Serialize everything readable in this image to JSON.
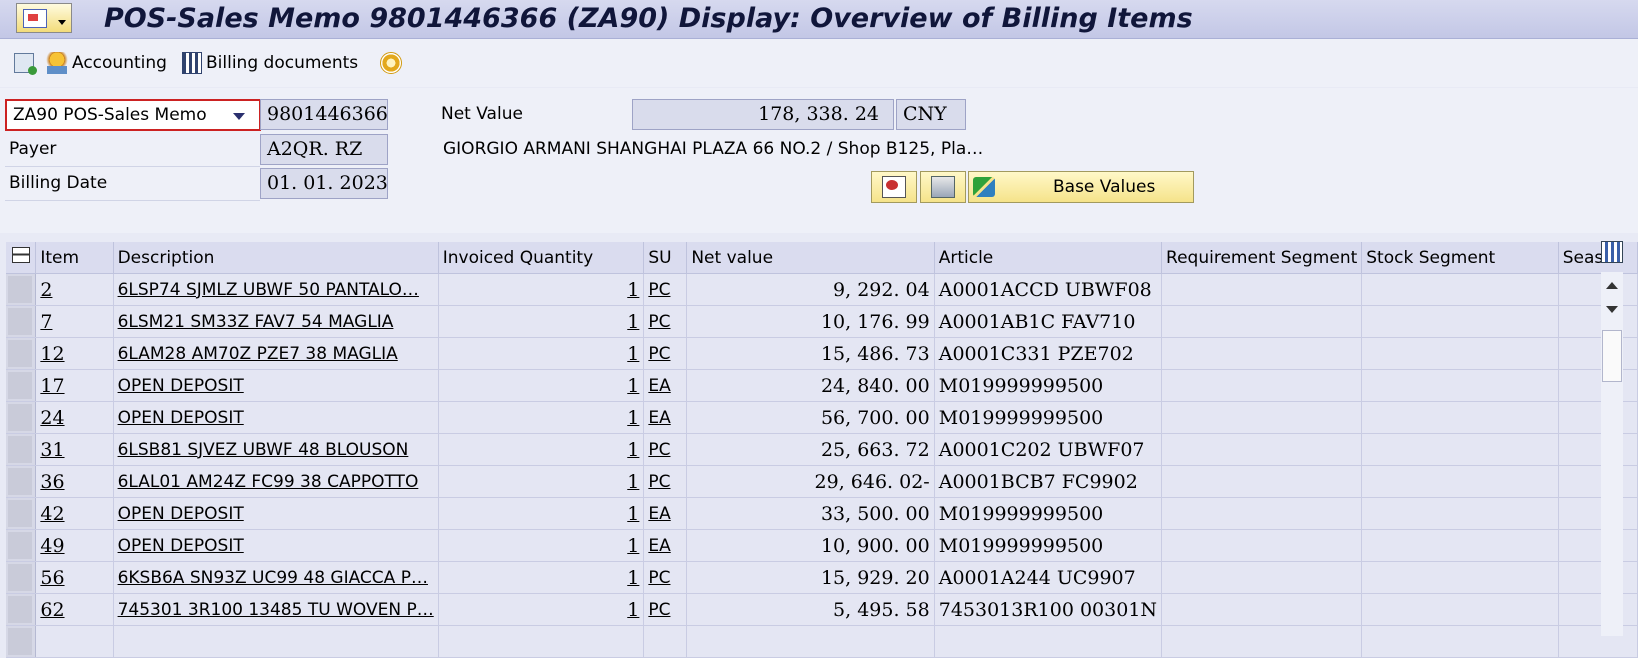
{
  "window": {
    "title": "POS-Sales Memo 9801446366 (ZA90) Display: Overview of Billing Items",
    "menu_icon": "sap-menu-icon"
  },
  "toolbar": {
    "accounting_label": "Accounting",
    "billing_documents_label": "Billing documents"
  },
  "header": {
    "doc_type": "ZA90 POS-Sales Memo",
    "doc_number": "9801446366",
    "net_value_label": "Net Value",
    "net_value": "178, 338. 24",
    "currency": "CNY",
    "payer_label": "Payer",
    "payer_value": "A2QR. RZ",
    "payer_name": "GIORGIO ARMANI SHANGHAI PLAZA 66 NO.2 / Shop B125, Pla…",
    "billing_date_label": "Billing Date",
    "billing_date": "01. 01. 2023",
    "base_values_label": "Base Values"
  },
  "table": {
    "columns": [
      "Item",
      "Description",
      "Invoiced Quantity",
      "SU",
      "Net value",
      "Article",
      "Requirement Segment",
      "Stock Segment",
      "Seas"
    ],
    "rows": [
      {
        "item": "2",
        "desc": "6LSP74 SJMLZ UBWF   50  PANTALO…",
        "qty": "1",
        "su": "PC",
        "net": "9, 292. 04",
        "article": "A0001ACCD  UBWF08"
      },
      {
        "item": "7",
        "desc": "6LSM21 SM33Z FAV7   54  MAGLIA",
        "qty": "1",
        "su": "PC",
        "net": "10, 176. 99",
        "article": "A0001AB1C  FAV710"
      },
      {
        "item": "12",
        "desc": "6LAM28 AM70Z PZE7   38  MAGLIA",
        "qty": "1",
        "su": "PC",
        "net": "15, 486. 73",
        "article": "A0001C331  PZE702"
      },
      {
        "item": "17",
        "desc": "OPEN DEPOSIT",
        "qty": "1",
        "su": "EA",
        "net": "24, 840. 00",
        "article": "M019999999500"
      },
      {
        "item": "24",
        "desc": "OPEN DEPOSIT",
        "qty": "1",
        "su": "EA",
        "net": "56, 700. 00",
        "article": "M019999999500"
      },
      {
        "item": "31",
        "desc": "6LSB81 SJVEZ UBWF   48  BLOUSON",
        "qty": "1",
        "su": "PC",
        "net": "25, 663. 72",
        "article": "A0001C202  UBWF07"
      },
      {
        "item": "36",
        "desc": "6LAL01 AM24Z FC99   38  CAPPOTTO",
        "qty": "1",
        "su": "PC",
        "net": "29, 646. 02-",
        "article": "A0001BCB7  FC9902"
      },
      {
        "item": "42",
        "desc": "OPEN DEPOSIT",
        "qty": "1",
        "su": "EA",
        "net": "33, 500. 00",
        "article": "M019999999500"
      },
      {
        "item": "49",
        "desc": "OPEN DEPOSIT",
        "qty": "1",
        "su": "EA",
        "net": "10, 900. 00",
        "article": "M019999999500"
      },
      {
        "item": "56",
        "desc": "6KSB6A SN93Z UC99   48  GIACCA P…",
        "qty": "1",
        "su": "PC",
        "net": "15, 929. 20",
        "article": "A0001A244  UC9907"
      },
      {
        "item": "62",
        "desc": "745301 3R100 13485   TU WOVEN P…",
        "qty": "1",
        "su": "PC",
        "net": "5, 495. 58",
        "article": "7453013R100  00301N"
      },
      {
        "item": "",
        "desc": "",
        "qty": "",
        "su": "",
        "net": "",
        "article": ""
      }
    ]
  }
}
